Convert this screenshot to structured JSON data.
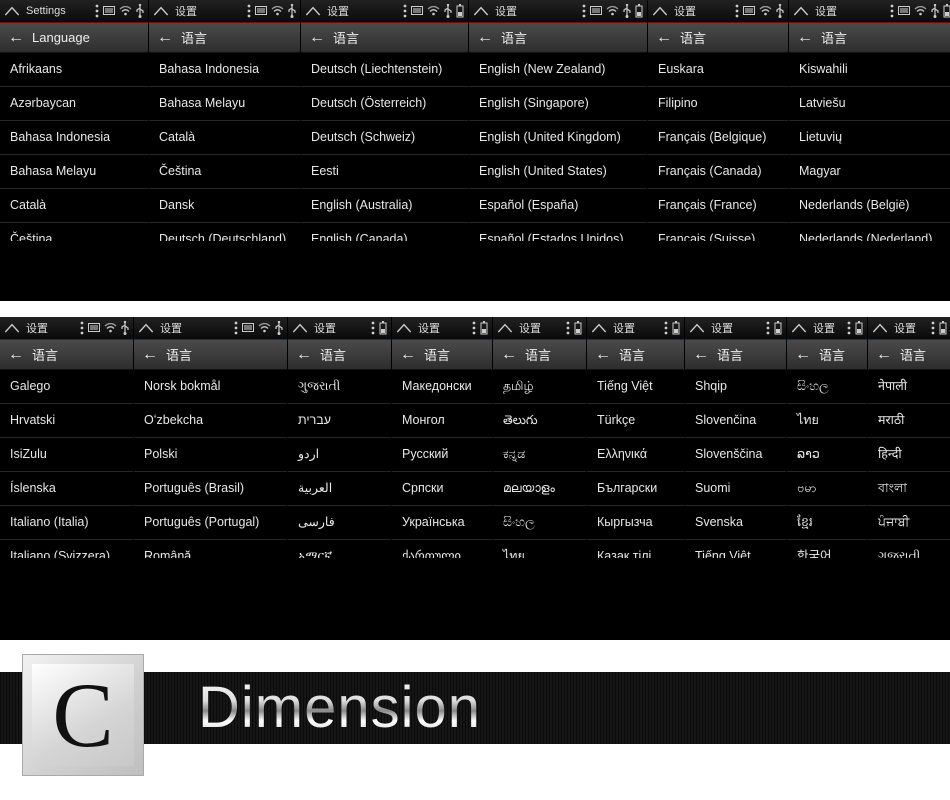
{
  "statusbar_titles": {
    "en": "Settings",
    "zh": "设置"
  },
  "nav_titles": {
    "en": "Language",
    "zh": "语言"
  },
  "rows": [
    {
      "panels": [
        {
          "w": 149,
          "sb": "en",
          "nav": "en",
          "items": [
            "Afrikaans",
            "Azərbaycan",
            "Bahasa Indonesia",
            "Bahasa Melayu",
            "Català",
            "Čeština"
          ]
        },
        {
          "w": 152,
          "sb": "zh",
          "nav": "zh",
          "items": [
            "Bahasa Indonesia",
            "Bahasa Melayu",
            "Català",
            "Čeština",
            "Dansk",
            "Deutsch (Deutschland)"
          ]
        },
        {
          "w": 168,
          "sb": "zh",
          "nav": "zh",
          "items": [
            "Deutsch (Liechtenstein)",
            "Deutsch (Österreich)",
            "Deutsch (Schweiz)",
            "Eesti",
            "English (Australia)",
            "English (Canada)"
          ]
        },
        {
          "w": 179,
          "sb": "zh",
          "nav": "zh",
          "items": [
            "English (New Zealand)",
            "English (Singapore)",
            "English (United Kingdom)",
            "English (United States)",
            "Español (España)",
            "Español (Estados Unidos)"
          ]
        },
        {
          "w": 141,
          "sb": "zh",
          "nav": "zh",
          "items": [
            "Euskara",
            "Filipino",
            "Français (Belgique)",
            "Français (Canada)",
            "Français (France)",
            "Français (Suisse)"
          ]
        },
        {
          "w": 167,
          "sb": "zh",
          "nav": "zh",
          "items": [
            "Kiswahili",
            "Latviešu",
            "Lietuvių",
            "Magyar",
            "Nederlands (België)",
            "Nederlands (Nederland)"
          ]
        }
      ]
    },
    {
      "panels": [
        {
          "w": 134,
          "sb": "zh",
          "nav": "zh",
          "items": [
            "Galego",
            "Hrvatski",
            "IsiZulu",
            "Íslenska",
            "Italiano (Italia)",
            "Italiano (Svizzera)"
          ]
        },
        {
          "w": 154,
          "sb": "zh",
          "nav": "zh",
          "items": [
            "Norsk bokmål",
            "Oʻzbekcha",
            "Polski",
            "Português (Brasil)",
            "Português (Portugal)",
            "Română"
          ]
        },
        {
          "w": 104,
          "sb": "zh",
          "nav": "zh",
          "items": [
            "ગુજરાતી",
            "עברית",
            "اردو",
            "العربية",
            "فارسی",
            "አማርኛ"
          ]
        },
        {
          "w": 101,
          "sb": "zh",
          "nav": "zh",
          "items": [
            "Македонски",
            "Монгол",
            "Русский",
            "Српски",
            "Українська",
            "ქართული"
          ]
        },
        {
          "w": 94,
          "sb": "zh",
          "nav": "zh",
          "items": [
            "தமிழ்",
            "తెలుగు",
            "ಕನ್ನಡ",
            "മലയാളം",
            "සිංහල",
            "ไทย"
          ]
        },
        {
          "w": 98,
          "sb": "zh",
          "nav": "zh",
          "items": [
            "Tiếng Việt",
            "Türkçe",
            "Ελληνικά",
            "Български",
            "Кыргызча",
            "Қазақ тілі"
          ]
        },
        {
          "w": 102,
          "sb": "zh",
          "nav": "zh",
          "items": [
            "Shqip",
            "Slovenčina",
            "Slovenščina",
            "Suomi",
            "Svenska",
            "Tiếng Việt"
          ]
        },
        {
          "w": 81,
          "sb": "zh",
          "nav": "zh",
          "items": [
            "සිංහල",
            "ไทย",
            "ລາວ",
            "ဗမာ",
            "ខ្មែរ",
            "한국어"
          ]
        },
        {
          "w": 84,
          "sb": "zh",
          "nav": "zh",
          "items": [
            "नेपाली",
            "मराठी",
            "हिन्दी",
            "বাংলা",
            "ਪੰਜਾਬੀ",
            "ગુજરાતી"
          ]
        }
      ]
    }
  ],
  "banner": {
    "letter": "C",
    "title": "Dimension"
  }
}
